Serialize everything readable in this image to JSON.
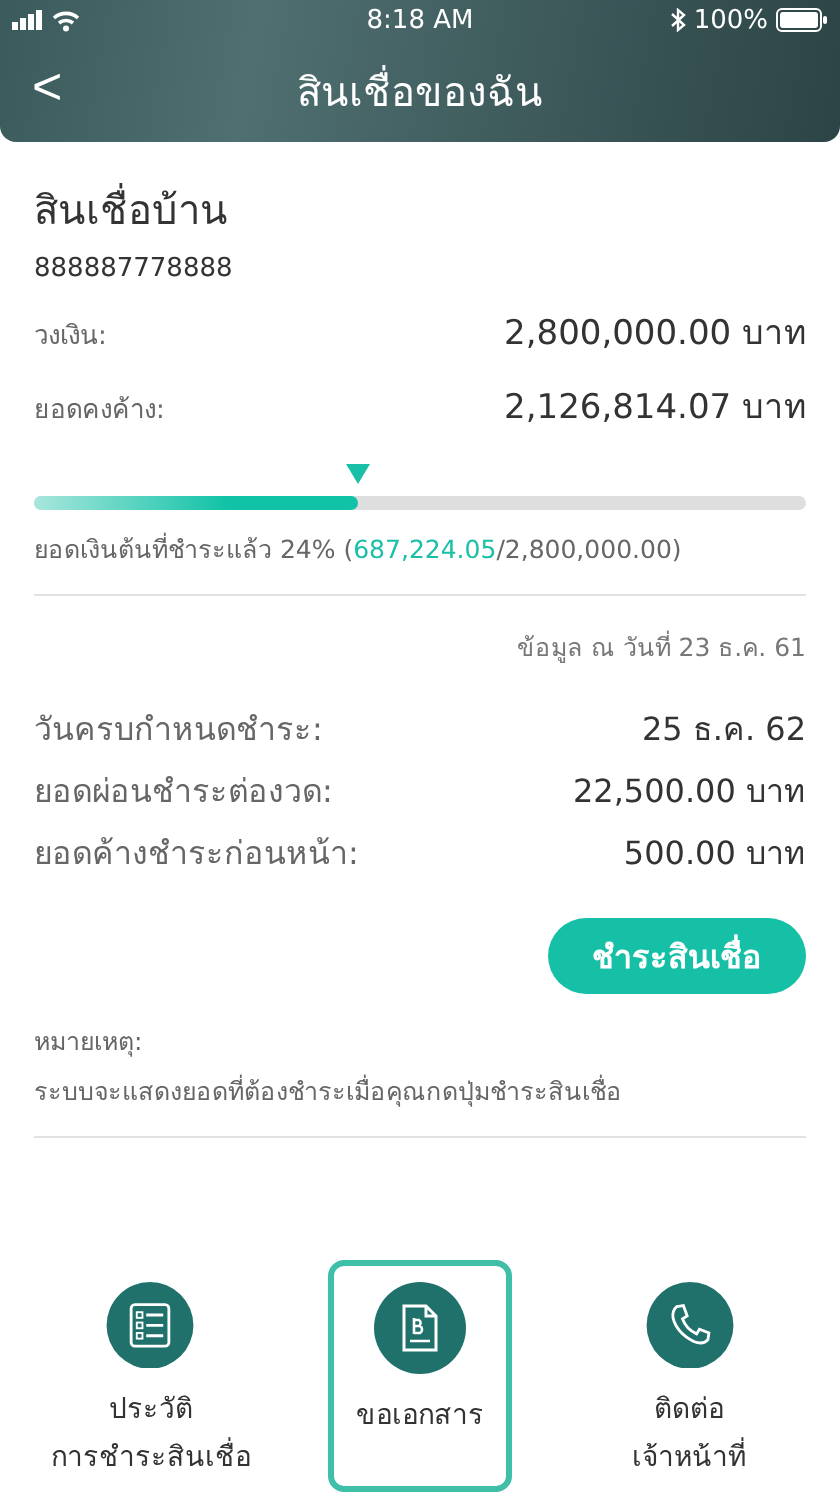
{
  "status_bar": {
    "time": "8:18 AM",
    "battery": "100%"
  },
  "header": {
    "back": "<",
    "title": "สินเชื่อของฉัน"
  },
  "loan": {
    "name": "สินเชื่อบ้าน",
    "account": "888887778888",
    "rows": [
      {
        "label": "วงเงิน:",
        "value": "2,800,000.00 บาท"
      },
      {
        "label": "ยอดคงค้าง:",
        "value": "2,126,814.07 บาท"
      }
    ],
    "progress": {
      "level": 0.42,
      "caption_prefix": "ยอดเงินต้นที่ชำระแล้ว 24% (",
      "paid": "687,224.05",
      "caption_suffix": "/2,800,000.00)"
    }
  },
  "as_of": "ข้อมูล ณ วันที่ 23 ธ.ค. 61",
  "details": [
    {
      "label": "วันครบกำหนดชำระ:",
      "value": "25 ธ.ค. 62"
    },
    {
      "label": "ยอดผ่อนชำระต่องวด:",
      "value": "22,500.00 บาท"
    },
    {
      "label": "ยอดค้างชำระก่อนหน้า:",
      "value": "500.00 บาท"
    }
  ],
  "pay_button": "ชำระสินเชื่อ",
  "note": {
    "title": "หมายเหตุ:",
    "text": "ระบบจะแสดงยอดที่ต้องชำระเมื่อคุณกดปุ่มชำระสินเชื่อ"
  },
  "actions": [
    {
      "kind": "list",
      "lines": [
        "ประวัติ",
        "การชำระสินเชื่อ"
      ],
      "selected": false
    },
    {
      "kind": "document",
      "lines": [
        "ขอเอกสาร"
      ],
      "selected": true
    },
    {
      "kind": "phone",
      "lines": [
        "ติดต่อ",
        "เจ้าหน้าที่"
      ],
      "selected": false
    }
  ]
}
